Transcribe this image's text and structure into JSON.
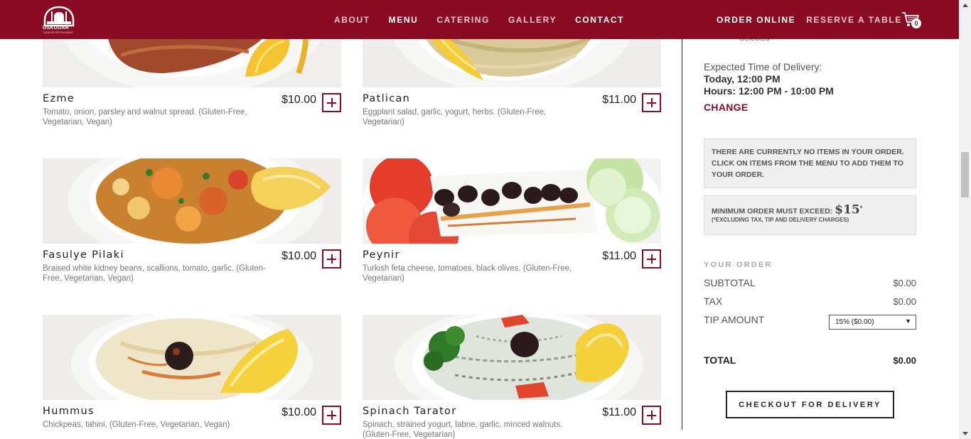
{
  "header": {
    "logo_text": "ÜSKÜDAR",
    "logo_subtext": "TURKISH RESTAURANT",
    "nav": [
      {
        "label": "ABOUT"
      },
      {
        "label": "MENU"
      },
      {
        "label": "CATERING"
      },
      {
        "label": "GALLERY"
      },
      {
        "label": "CONTACT"
      }
    ],
    "order_online": "ORDER ONLINE",
    "reserve": "RESERVE A TABLE",
    "cart_count": "0",
    "colors": {
      "brand": "#8a0b24"
    }
  },
  "menu": {
    "items": [
      {
        "name": "Ezme",
        "price": "$10.00",
        "desc": "Tomato, onion, parsley and walnut spread. (Gluten-Free, Vegetarian, Vegan)",
        "icon": "plus-icon"
      },
      {
        "name": "Patlican",
        "price": "$11.00",
        "desc": "Eggplant salad, garlic, yogurt, herbs. (Gluten-Free, Vegetarian)",
        "icon": "plus-icon"
      },
      {
        "name": "Fasulye Pilaki",
        "price": "$10.00",
        "desc": "Braised white kidney beans, scallions, tomato, garlic. (Gluten-Free, Vegetarian, Vegan)",
        "icon": "plus-icon"
      },
      {
        "name": "Peynir",
        "price": "$11.00",
        "desc": "Turkish feta cheese, tomatoes, black olives. (Gluten-Free, Vegetarian)",
        "icon": "plus-icon"
      },
      {
        "name": "Hummus",
        "price": "$10.00",
        "desc": "Chickpeas, tahini. (Gluten-Free, Vegetarian, Vegan)",
        "icon": "plus-icon"
      },
      {
        "name": "Spinach Tarator",
        "price": "$11.00",
        "desc": "Spinach, strained yogurt, labne, garlic, minced walnuts. (Gluten-Free, Vegetarian)",
        "icon": "plus-icon"
      }
    ]
  },
  "sidebar": {
    "selected": "Selected",
    "delivery_label": "Expected Time of Delivery:",
    "delivery_today": "Today, 12:00 PM",
    "delivery_hours": "Hours: 12:00 PM - 10:00 PM",
    "change": "CHANGE",
    "empty_notice": "THERE ARE CURRENTLY NO ITEMS IN YOUR ORDER. CLICK ON ITEMS FROM THE MENU TO ADD THEM TO YOUR ORDER.",
    "min_order_label": "MINIMUM ORDER MUST EXCEED:",
    "min_order_amount": "$15",
    "min_order_star": "*",
    "min_order_note": "(*EXCLUDING TAX, TIP AND DELIVERY CHARGES)",
    "your_order": "YOUR ORDER",
    "subtotal_label": "SUBTOTAL",
    "subtotal_value": "$0.00",
    "tax_label": "TAX",
    "tax_value": "$0.00",
    "tip_label": "TIP AMOUNT",
    "tip_selected": "15% ($0.00)",
    "total_label": "TOTAL",
    "total_value": "$0.00",
    "checkout": "CHECKOUT FOR DELIVERY"
  }
}
